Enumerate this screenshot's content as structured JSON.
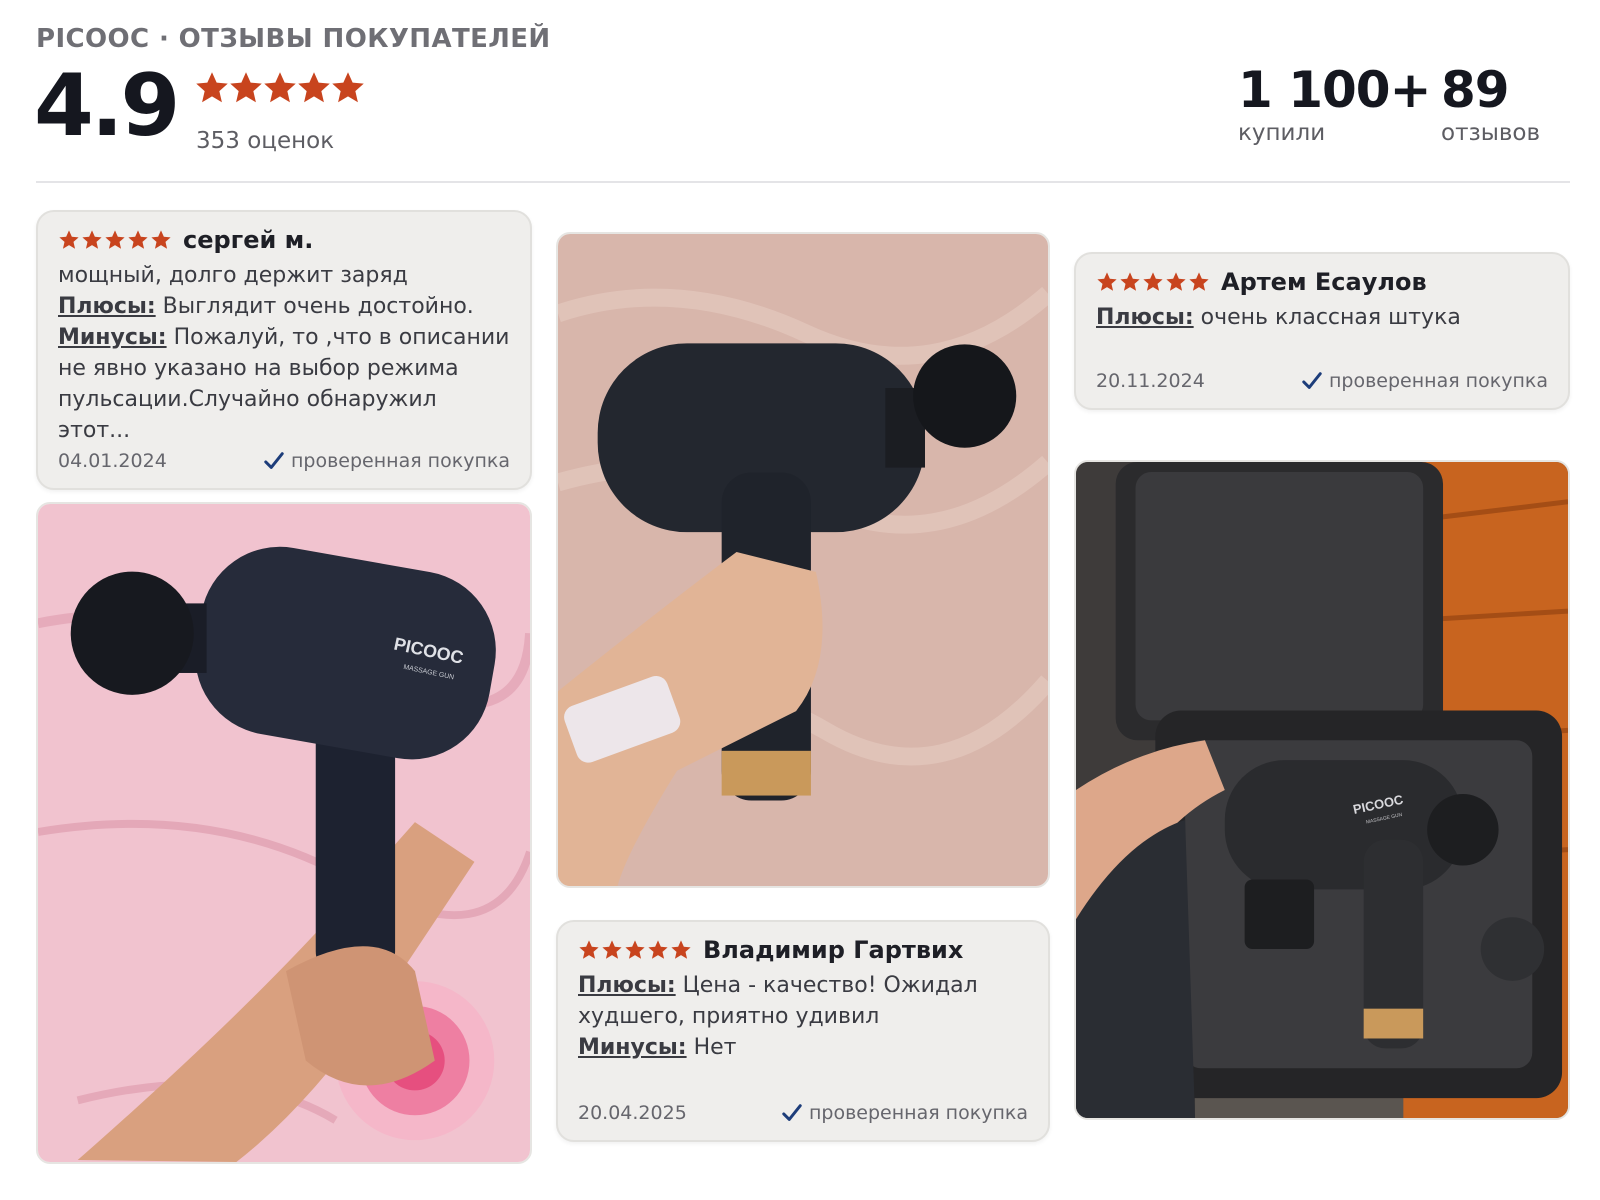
{
  "header": {
    "brand_title": "PICOOC · ОТЗЫВЫ ПОКУПАТЕЛЕЙ",
    "average_rating": "4.9",
    "stars": 5,
    "ratings_count": "353 оценок",
    "bought_value": "1 100+",
    "bought_label": "купили",
    "reviews_value": "89",
    "reviews_label": "отзывов"
  },
  "colors": {
    "star": "#c8441e",
    "check": "#1d3d7a",
    "card_bg": "#efeeec"
  },
  "reviews": [
    {
      "author": "сергей м.",
      "stars": 5,
      "text": "мощный, долго держит заряд",
      "pros_label": "Плюсы:",
      "pros": "Выглядит очень достойно.",
      "cons_label": "Минусы:",
      "cons": "Пожалуй, то ,что в описании не явно указано на выбор режима пульсации.Случайно обнаружил этот...",
      "date": "04.01.2024",
      "verified": "проверенная покупка"
    },
    {
      "author": "Артем Есаулов",
      "stars": 5,
      "pros_label": "Плюсы:",
      "pros": "очень классная штука",
      "date": "20.11.2024",
      "verified": "проверенная покупка"
    },
    {
      "author": "Владимир Гартвих",
      "stars": 5,
      "pros_label": "Плюсы:",
      "pros": "Цена - качество! Ожидал худшего, приятно удивил",
      "cons_label": "Минусы:",
      "cons": "Нет",
      "date": "20.04.2025",
      "verified": "проверенная покупка"
    }
  ],
  "photos": [
    {
      "brand_text": "PICOOC",
      "sub_text": "MASSAGE GUN"
    },
    {
      "brand_text": "PICOOC",
      "sub_text": "MASSAGE GUN"
    }
  ]
}
